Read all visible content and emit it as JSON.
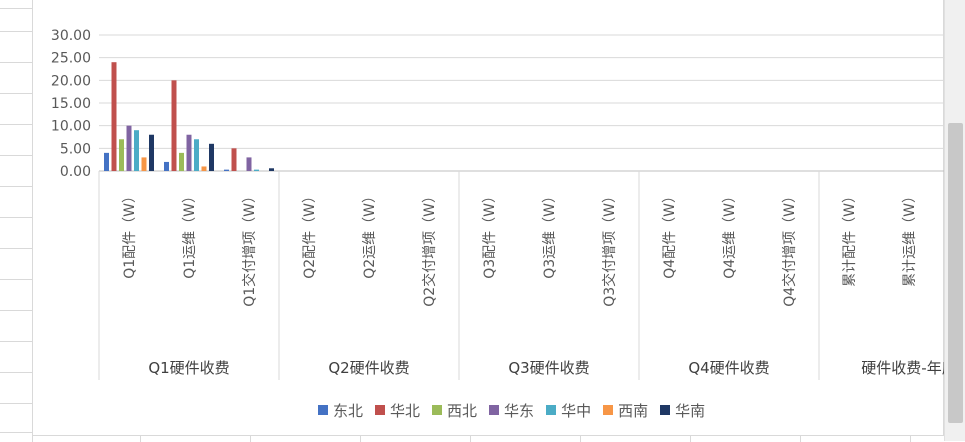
{
  "chart_data": {
    "type": "bar",
    "title": "",
    "ylim": [
      0,
      30
    ],
    "yticks": [
      "0.00",
      "5.00",
      "10.00",
      "15.00",
      "20.00",
      "25.00",
      "30.00"
    ],
    "grid": true,
    "legend_position": "bottom",
    "categories": [
      "Q1配件（W）",
      "Q1运维（W）",
      "Q1交付增项（W）",
      "Q2配件（W）",
      "Q2运维（W）",
      "Q2交付增项（W）",
      "Q3配件（W）",
      "Q3运维（W）",
      "Q3交付增项（W）",
      "Q4配件（W）",
      "Q4运维（W）",
      "Q4交付增项（W）",
      "累计配件（W）",
      "累计运维（W）"
    ],
    "groups": [
      "Q1硬件收费",
      "Q2硬件收费",
      "Q3硬件收费",
      "Q4硬件收费",
      "硬件收费-年度"
    ],
    "series": [
      {
        "name": "东北",
        "color": "#4472c4",
        "values": [
          4,
          2,
          0.3,
          0,
          0,
          0,
          0,
          0,
          0,
          0,
          0,
          0,
          0,
          0
        ]
      },
      {
        "name": "华北",
        "color": "#c0504d",
        "values": [
          24,
          20,
          5,
          0,
          0,
          0,
          0,
          0,
          0,
          0,
          0,
          0,
          0,
          0
        ]
      },
      {
        "name": "西北",
        "color": "#9bbb59",
        "values": [
          7,
          4,
          0,
          0,
          0,
          0,
          0,
          0,
          0,
          0,
          0,
          0,
          0,
          0
        ]
      },
      {
        "name": "华东",
        "color": "#8064a2",
        "values": [
          10,
          8,
          3,
          0,
          0,
          0,
          0,
          0,
          0,
          0,
          0,
          0,
          0,
          0
        ]
      },
      {
        "name": "华中",
        "color": "#4bacc6",
        "values": [
          9,
          7,
          0.3,
          0,
          0,
          0,
          0,
          0,
          0,
          0,
          0,
          0,
          0,
          0
        ]
      },
      {
        "name": "西南",
        "color": "#f79646",
        "values": [
          3,
          1,
          0,
          0,
          0,
          0,
          0,
          0,
          0,
          0,
          0,
          0,
          0,
          0
        ]
      },
      {
        "name": "华南",
        "color": "#1f3864",
        "values": [
          8,
          6,
          0.6,
          0,
          0,
          0,
          0,
          0,
          0,
          0,
          0,
          0,
          0,
          0
        ]
      }
    ]
  }
}
